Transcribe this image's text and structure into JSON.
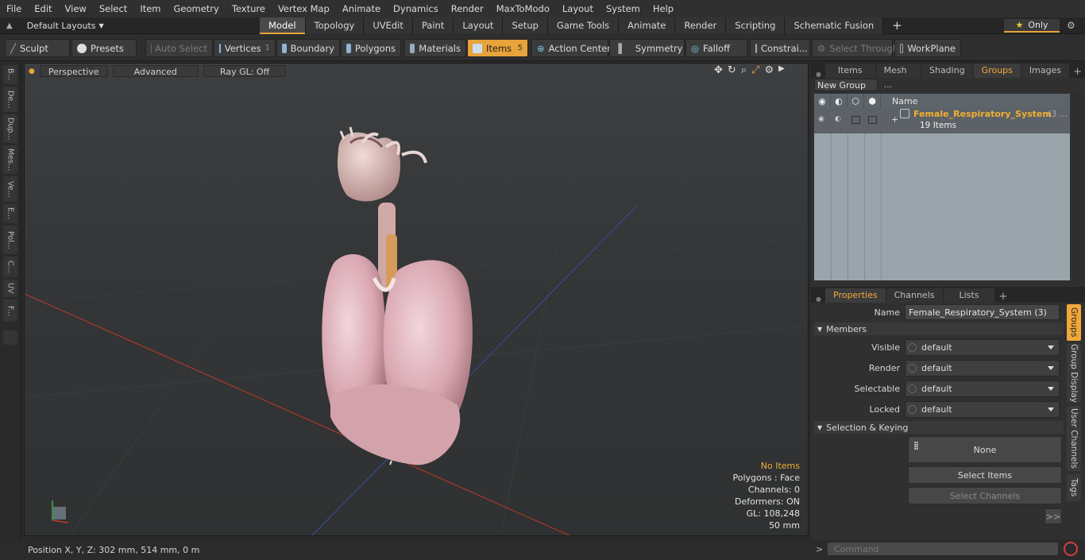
{
  "menu": [
    "File",
    "Edit",
    "View",
    "Select",
    "Item",
    "Geometry",
    "Texture",
    "Vertex Map",
    "Animate",
    "Dynamics",
    "Render",
    "MaxToModo",
    "Layout",
    "System",
    "Help"
  ],
  "layouts": {
    "label": "Default Layouts"
  },
  "tabs": [
    "Model",
    "Topology",
    "UVEdit",
    "Paint",
    "Layout",
    "Setup",
    "Game Tools",
    "Animate",
    "Render",
    "Scripting",
    "Schematic Fusion"
  ],
  "only_label": "Only",
  "toolbar": {
    "sculpt": "Sculpt",
    "presets": "Presets",
    "auto_select": "Auto Select",
    "vertices": "Vertices",
    "vertices_count": "1",
    "boundary": "Boundary",
    "polygons": "Polygons",
    "materials": "Materials",
    "items": "Items",
    "items_count": "5",
    "action_center": "Action Center",
    "symmetry": "Symmetry",
    "falloff": "Falloff",
    "constraints": "Constrai...",
    "select_through": "Select Through",
    "workplane": "WorkPlane"
  },
  "left_tabs": [
    "B...",
    "De...",
    "Dup...",
    "Mes...",
    "Ve...",
    "E...",
    "Pol...",
    "C...",
    "UV",
    "F..."
  ],
  "viewport": {
    "perspective": "Perspective",
    "advanced": "Advanced",
    "raygl": "Ray GL: Off",
    "info": {
      "items": "No Items",
      "polygons": "Polygons : Face",
      "channels": "Channels: 0",
      "deformers": "Deformers: ON",
      "gl": "GL: 108,248",
      "scale": "50 mm"
    }
  },
  "status": {
    "position": "Position X, Y, Z:   302 mm, 514 mm, 0 m"
  },
  "top_panel": {
    "tabs": [
      "Items",
      "Mesh ...",
      "Shading",
      "Groups",
      "Images"
    ],
    "new_group": "New Group",
    "name_col": "Name",
    "group": {
      "name": "Female_Respiratory_System",
      "suffix": "(3 ...",
      "count": "19 Items"
    }
  },
  "properties": {
    "tabs": [
      "Properties",
      "Channels",
      "Lists"
    ],
    "name_label": "Name",
    "name_value": "Female_Respiratory_System (3)",
    "members": "Members",
    "rows": [
      {
        "label": "Visible",
        "value": "default"
      },
      {
        "label": "Render",
        "value": "default"
      },
      {
        "label": "Selectable",
        "value": "default"
      },
      {
        "label": "Locked",
        "value": "default"
      }
    ],
    "selection_keying": "Selection & Keying",
    "none": "None",
    "select_items": "Select Items",
    "select_channels": "Select Channels",
    "more": ">>",
    "side_tabs": [
      "Groups",
      "Group Display",
      "User Channels",
      "Tags"
    ]
  },
  "command": {
    "placeholder": "Command"
  },
  "colors": {
    "accent": "#e8a33a",
    "group_name": "#f0b030"
  }
}
